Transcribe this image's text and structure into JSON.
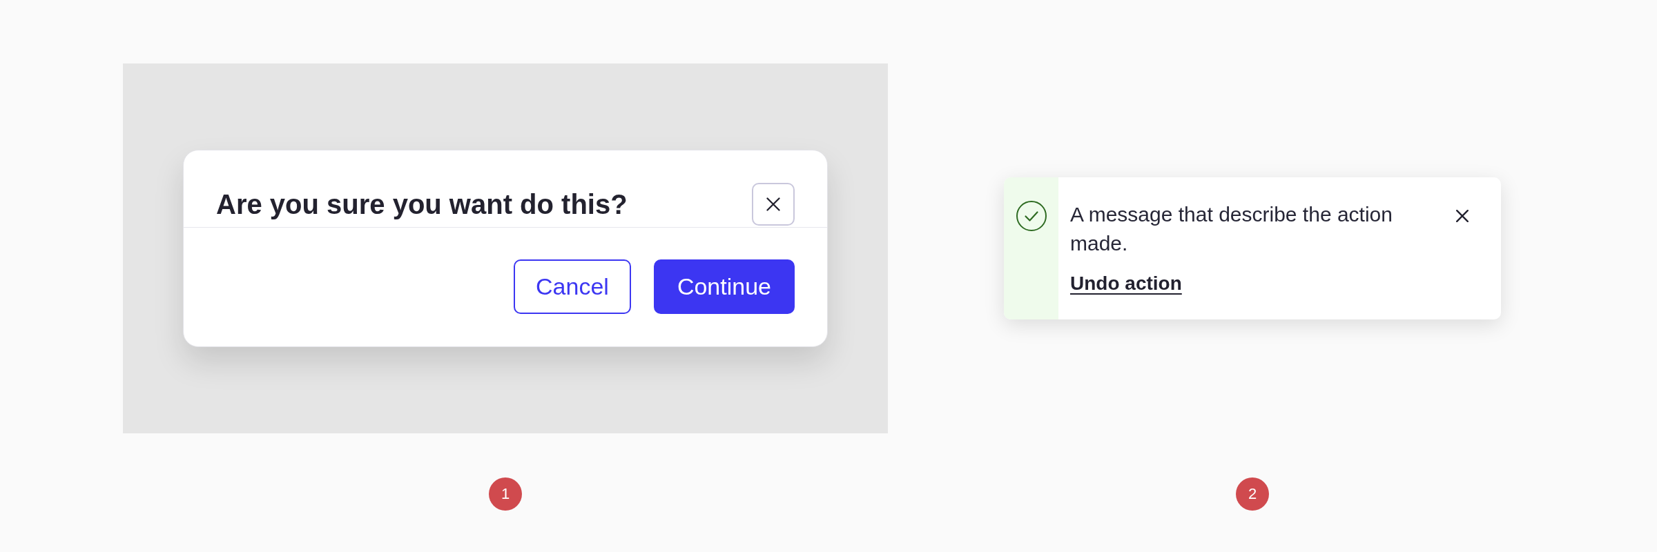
{
  "dialog": {
    "title": "Are you sure you want do this?",
    "buttons": [
      {
        "label": "Cancel",
        "kind": "secondary"
      },
      {
        "label": "Continue",
        "kind": "primary"
      }
    ],
    "marker": "1"
  },
  "toast": {
    "kind": "success",
    "message": "A message that describe the action made.",
    "action": "Undo action",
    "marker": "2"
  }
}
